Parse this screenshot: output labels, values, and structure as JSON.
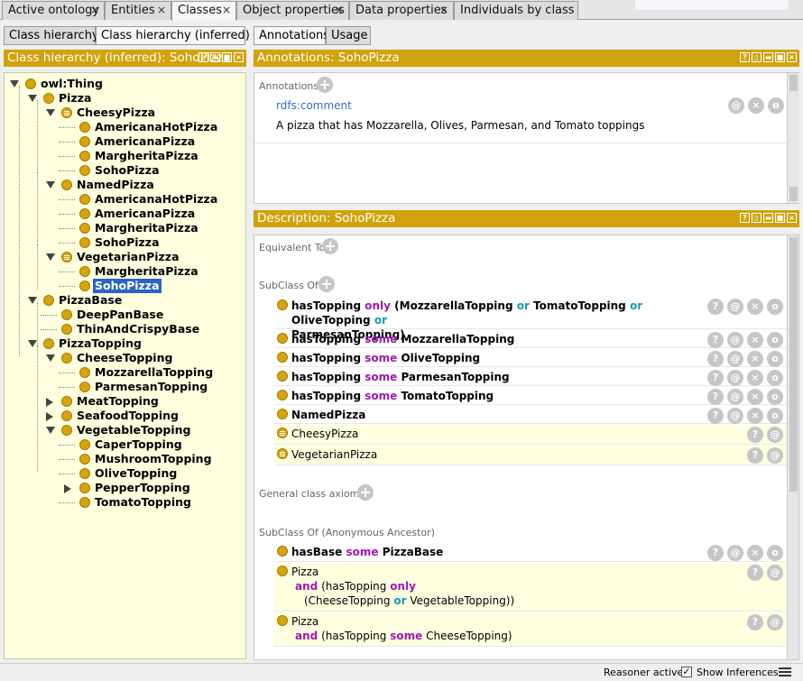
{
  "tabs": [
    {
      "label": "Active ontology",
      "x": "×"
    },
    {
      "label": "Entities",
      "x": "×"
    },
    {
      "label": "Classes",
      "x": "×"
    },
    {
      "label": "Object properties",
      "x": "×"
    },
    {
      "label": "Data properties",
      "x": "×"
    },
    {
      "label": "Individuals by class",
      "x": ""
    }
  ],
  "left_tabs": [
    "Class hierarchy",
    "Class hierarchy (inferred)"
  ],
  "left_header": "Class hierarchy (inferred): SohoPizza",
  "right_tabs": [
    "Annotations",
    "Usage"
  ],
  "ann_header": "Annotations: SohoPizza",
  "annotations": {
    "section": "Annotations",
    "property": "rdfs:comment",
    "value": "A pizza that  has Mozzarella, Olives, Parmesan, and Tomato toppings"
  },
  "desc_header": "Description: SohoPizza",
  "desc": {
    "equiv": "Equivalent To",
    "subclass": "SubClass Of",
    "gca": "General class axioms",
    "anc": "SubClass Of (Anonymous Ancestor)"
  },
  "tree": [
    {
      "label": "owl:Thing",
      "kind": "class"
    },
    {
      "label": "Pizza",
      "kind": "class"
    },
    {
      "label": "CheesyPizza",
      "kind": "defined"
    },
    {
      "label": "AmericanaHotPizza",
      "kind": "class"
    },
    {
      "label": "AmericanaPizza",
      "kind": "class"
    },
    {
      "label": "MargheritaPizza",
      "kind": "class"
    },
    {
      "label": "SohoPizza",
      "kind": "class"
    },
    {
      "label": "NamedPizza",
      "kind": "class"
    },
    {
      "label": "AmericanaHotPizza",
      "kind": "class"
    },
    {
      "label": "AmericanaPizza",
      "kind": "class"
    },
    {
      "label": "MargheritaPizza",
      "kind": "class"
    },
    {
      "label": "SohoPizza",
      "kind": "class"
    },
    {
      "label": "VegetarianPizza",
      "kind": "defined"
    },
    {
      "label": "MargheritaPizza",
      "kind": "class"
    },
    {
      "label": "SohoPizza",
      "kind": "class",
      "selected": true
    },
    {
      "label": "PizzaBase",
      "kind": "class"
    },
    {
      "label": "DeepPanBase",
      "kind": "class"
    },
    {
      "label": "ThinAndCrispyBase",
      "kind": "class"
    },
    {
      "label": "PizzaTopping",
      "kind": "class"
    },
    {
      "label": "CheeseTopping",
      "kind": "class"
    },
    {
      "label": "MozzarellaTopping",
      "kind": "class"
    },
    {
      "label": "ParmesanTopping",
      "kind": "class"
    },
    {
      "label": "MeatTopping",
      "kind": "class"
    },
    {
      "label": "SeafoodTopping",
      "kind": "class"
    },
    {
      "label": "VegetableTopping",
      "kind": "class"
    },
    {
      "label": "CaperTopping",
      "kind": "class"
    },
    {
      "label": "MushroomTopping",
      "kind": "class"
    },
    {
      "label": "OliveTopping",
      "kind": "class"
    },
    {
      "label": "PepperTopping",
      "kind": "class"
    },
    {
      "label": "TomatoTopping",
      "kind": "class"
    }
  ],
  "subclass_rows": [
    {
      "p": "hasTopping",
      "k": "only",
      "rest": [
        "(MozzarellaTopping",
        "or",
        "TomatoTopping",
        "or",
        "OliveTopping",
        "or"
      ],
      "rest2": "ParmesanTopping)"
    },
    {
      "p": "hasTopping",
      "k": "some",
      "f": "MozzarellaTopping"
    },
    {
      "p": "hasTopping",
      "k": "some",
      "f": "OliveTopping"
    },
    {
      "p": "hasTopping",
      "k": "some",
      "f": "ParmesanTopping"
    },
    {
      "p": "hasTopping",
      "k": "some",
      "f": "TomatoTopping"
    },
    {
      "named": "NamedPizza"
    },
    {
      "inferred": "CheesyPizza"
    },
    {
      "inferred": "VegetarianPizza"
    }
  ],
  "ancestor_rows": {
    "r1": {
      "p": "hasBase",
      "k": "some",
      "f": "PizzaBase"
    },
    "r2": {
      "l1": "Pizza",
      "and": "and",
      "l2a": "(hasTopping",
      "only": "only",
      "l3a": "(CheeseTopping",
      "or": "or",
      "l3b": "VegetableTopping))"
    },
    "r3": {
      "l1": "Pizza",
      "and": "and",
      "l2a": "(hasTopping",
      "some": "some",
      "l2b": "CheeseTopping)"
    }
  },
  "buttons": {
    "help": "?",
    "annotate": "@",
    "delete": "×",
    "edit": "o"
  },
  "status": {
    "reasoner": "Reasoner active",
    "show": "Show Inferences",
    "checked": "✓"
  },
  "colors": {
    "header": "#d0a30c",
    "class": "#d8a40c",
    "keyword": "#a019b0",
    "connective": "#1a9ab3",
    "tree_bg": "#ffffe0",
    "selection": "#2b63c7"
  }
}
